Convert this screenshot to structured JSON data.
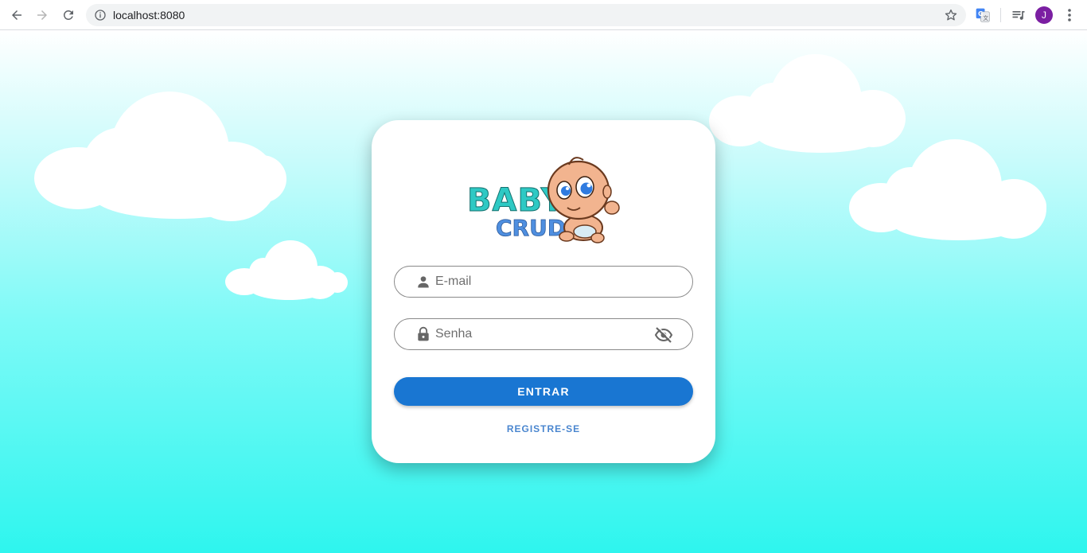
{
  "browser": {
    "url": "localhost:8080",
    "avatar_letter": "J"
  },
  "logo": {
    "line1": "BABY",
    "line2": "CRUD"
  },
  "login": {
    "email_placeholder": "E-mail",
    "password_placeholder": "Senha",
    "submit_label": "ENTRAR",
    "register_label": "REGISTRE-SE"
  },
  "colors": {
    "primary": "#1976d2",
    "link": "#4a86cf",
    "logo_teal": "#2ec9c4",
    "logo_blue": "#4f8fe0",
    "avatar": "#7b1fa2",
    "sky_bottom": "#2ef5ee"
  }
}
